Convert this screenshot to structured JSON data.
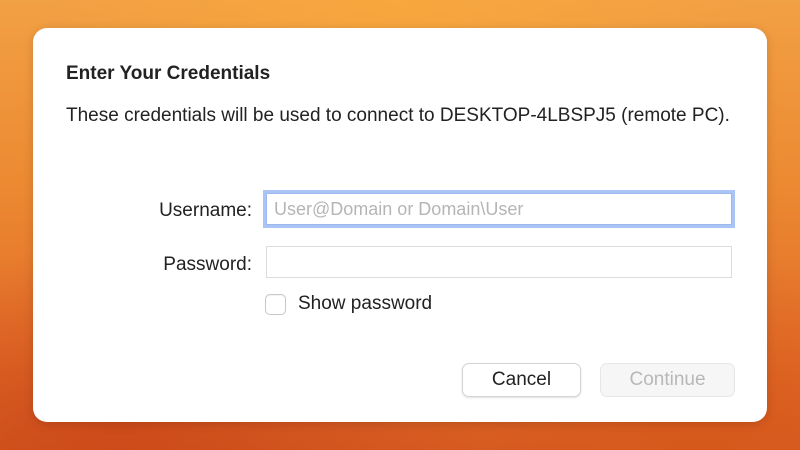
{
  "dialog": {
    "title": "Enter Your Credentials",
    "message": "These credentials will be used to connect to DESKTOP-4LBSPJ5 (remote PC).",
    "username": {
      "label": "Username:",
      "value": "",
      "placeholder": "User@Domain or Domain\\User"
    },
    "password": {
      "label": "Password:",
      "value": "",
      "placeholder": ""
    },
    "show_password": {
      "label": "Show password",
      "checked": false
    },
    "buttons": {
      "cancel": "Cancel",
      "continue": "Continue"
    }
  },
  "colors": {
    "focus_ring": "#a9c4f5",
    "background_orange": "#ec8a32",
    "disabled_text": "#b8b8b8"
  }
}
